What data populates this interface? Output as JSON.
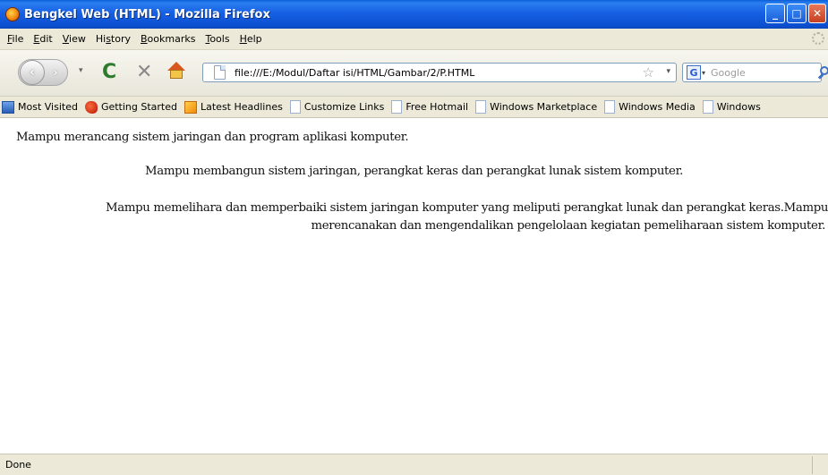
{
  "window": {
    "title": "Bengkel Web (HTML) - Mozilla Firefox",
    "minimize": "_",
    "maximize": "□",
    "close": "✕"
  },
  "menu": [
    {
      "label": "File",
      "key": "F",
      "rest": "ile"
    },
    {
      "label": "Edit",
      "key": "E",
      "rest": "dit"
    },
    {
      "label": "View",
      "key": "V",
      "rest": "iew"
    },
    {
      "label": "History",
      "key": "s",
      "pre": "Hi",
      "rest": "tory"
    },
    {
      "label": "Bookmarks",
      "key": "B",
      "rest": "ookmarks"
    },
    {
      "label": "Tools",
      "key": "T",
      "rest": "ools"
    },
    {
      "label": "Help",
      "key": "H",
      "rest": "elp"
    }
  ],
  "toolbar": {
    "url": "file:///E:/Modul/Daftar isi/HTML/Gambar/2/P.HTML",
    "search_placeholder": "Google",
    "search_engine_icon": "G",
    "back_icon": "‹",
    "forward_icon": "›",
    "dropdown_icon": "▾",
    "reload_icon": "C",
    "stop_icon": "✕",
    "star_icon": "☆"
  },
  "bookmarks": [
    {
      "label": "Most Visited",
      "icon": "most-visited-icon"
    },
    {
      "label": "Getting Started",
      "icon": "getting-started-icon"
    },
    {
      "label": "Latest Headlines",
      "icon": "rss-icon"
    },
    {
      "label": "Customize Links",
      "icon": "page-icon"
    },
    {
      "label": "Free Hotmail",
      "icon": "page-icon"
    },
    {
      "label": "Windows Marketplace",
      "icon": "page-icon"
    },
    {
      "label": "Windows Media",
      "icon": "page-icon"
    },
    {
      "label": "Windows",
      "icon": "page-icon"
    }
  ],
  "content": {
    "p1": "Mampu merancang sistem jaringan dan program aplikasi komputer.",
    "p2": "Mampu membangun sistem jaringan, perangkat keras dan perangkat lunak sistem komputer.",
    "p3_line1": "Mampu memelihara dan memperbaiki sistem jaringan komputer yang meliputi perangkat lunak dan perangkat keras.Mampu",
    "p3_line2": "merencanakan dan mengendalikan pengelolaan kegiatan pemeliharaan sistem komputer."
  },
  "status": {
    "text": "Done"
  }
}
